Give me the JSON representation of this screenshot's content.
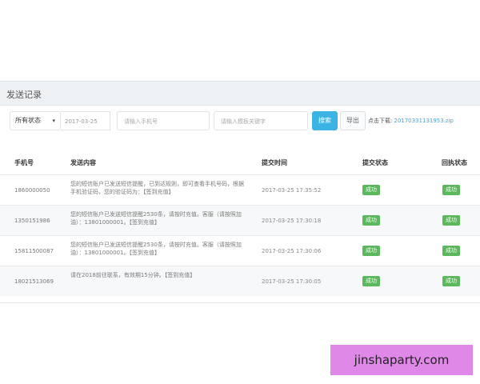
{
  "panel": {
    "title": "发送记录"
  },
  "toolbar": {
    "status_select": "所有状态",
    "date_value": "2017-03-25",
    "phone_placeholder": "请输入手机号",
    "keyword_placeholder": "请输入模板关键字",
    "search_label": "搜索",
    "export_label": "导出",
    "download_label": "点击下载:",
    "download_link": "20170331131953.zip"
  },
  "table": {
    "headers": [
      "手机号",
      "发送内容",
      "提交时间",
      "提交状态",
      "回执状态"
    ],
    "rows": [
      {
        "phone": "1860000050",
        "content": "您的短信账户已发送短信提醒，已到达规则，即可查看手机号码，根据手机验证码，您的验证码为：【签到充值】",
        "time": "2017-03-25 17:35:52",
        "submit_status": "成功",
        "receipt_status": "成功"
      },
      {
        "phone": "1350151986",
        "content": "您的短信账户已发送短信提醒2530条，请按时充值。客服（请按照加油）：13801000001。【签到充值】",
        "time": "2017-03-25 17:30:18",
        "submit_status": "成功",
        "receipt_status": "成功"
      },
      {
        "phone": "15811500087",
        "content": "您的短信账户已发送短信提醒2530条，请按时充值。客服（请按照加油）：13801000001。【签到充值】",
        "time": "2017-03-25 17:30:06",
        "submit_status": "成功",
        "receipt_status": "成功"
      },
      {
        "phone": "18021513069",
        "content": "请在2018前往联系，有效期15分钟。【签到充值】",
        "time": "2017-03-25 17:30:05",
        "submit_status": "成功",
        "receipt_status": "成功"
      }
    ]
  },
  "watermark": {
    "text": "jinshaparty.com"
  },
  "colors": {
    "accent": "#3bb4e3",
    "success": "#5cb85c",
    "watermark_bg": "#df88e8"
  }
}
